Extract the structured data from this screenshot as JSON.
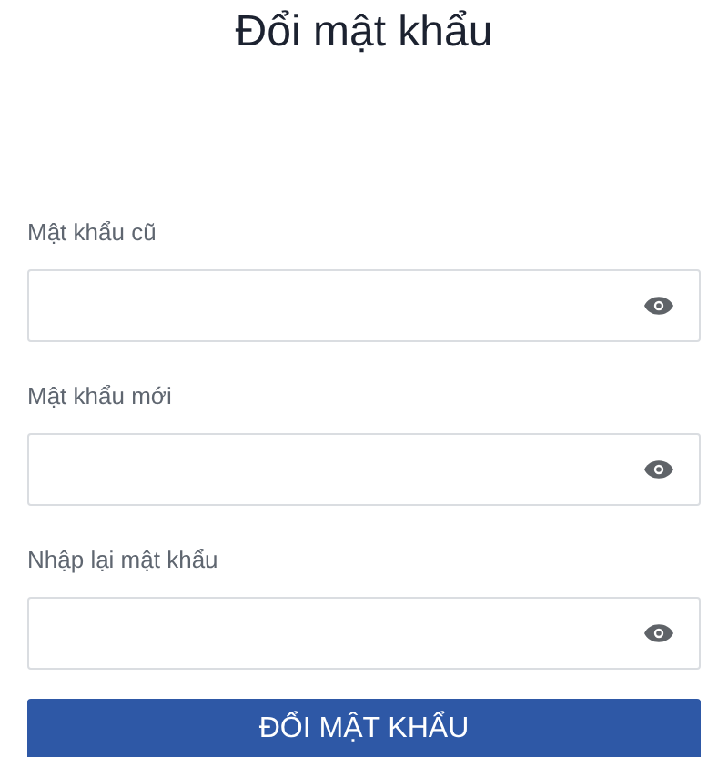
{
  "title": "Đổi mật khẩu",
  "fields": [
    {
      "label": "Mật khẩu cũ"
    },
    {
      "label": "Mật khẩu mới"
    },
    {
      "label": "Nhập lại mật khẩu"
    }
  ],
  "submit_button": "ĐỔI MẬT KHẨU"
}
